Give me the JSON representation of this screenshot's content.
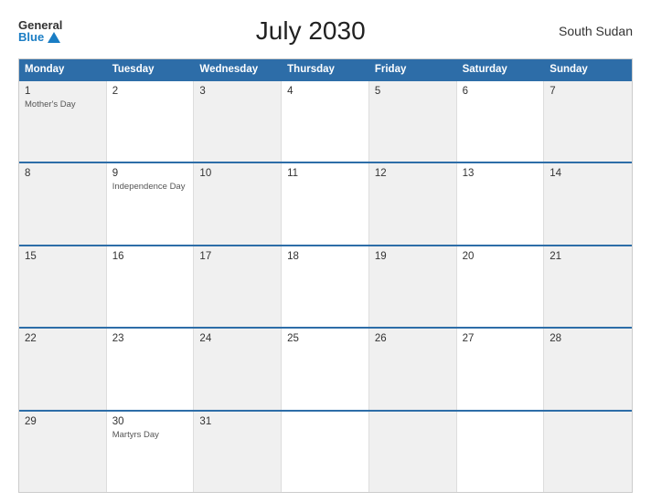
{
  "header": {
    "logo_general": "General",
    "logo_blue": "Blue",
    "title": "July 2030",
    "country": "South Sudan"
  },
  "calendar": {
    "days_of_week": [
      "Monday",
      "Tuesday",
      "Wednesday",
      "Thursday",
      "Friday",
      "Saturday",
      "Sunday"
    ],
    "weeks": [
      [
        {
          "day": "1",
          "event": "Mother's Day",
          "gray": true
        },
        {
          "day": "2",
          "event": "",
          "gray": false
        },
        {
          "day": "3",
          "event": "",
          "gray": true
        },
        {
          "day": "4",
          "event": "",
          "gray": false
        },
        {
          "day": "5",
          "event": "",
          "gray": true
        },
        {
          "day": "6",
          "event": "",
          "gray": false
        },
        {
          "day": "7",
          "event": "",
          "gray": true
        }
      ],
      [
        {
          "day": "8",
          "event": "",
          "gray": true
        },
        {
          "day": "9",
          "event": "Independence Day",
          "gray": false
        },
        {
          "day": "10",
          "event": "",
          "gray": true
        },
        {
          "day": "11",
          "event": "",
          "gray": false
        },
        {
          "day": "12",
          "event": "",
          "gray": true
        },
        {
          "day": "13",
          "event": "",
          "gray": false
        },
        {
          "day": "14",
          "event": "",
          "gray": true
        }
      ],
      [
        {
          "day": "15",
          "event": "",
          "gray": true
        },
        {
          "day": "16",
          "event": "",
          "gray": false
        },
        {
          "day": "17",
          "event": "",
          "gray": true
        },
        {
          "day": "18",
          "event": "",
          "gray": false
        },
        {
          "day": "19",
          "event": "",
          "gray": true
        },
        {
          "day": "20",
          "event": "",
          "gray": false
        },
        {
          "day": "21",
          "event": "",
          "gray": true
        }
      ],
      [
        {
          "day": "22",
          "event": "",
          "gray": true
        },
        {
          "day": "23",
          "event": "",
          "gray": false
        },
        {
          "day": "24",
          "event": "",
          "gray": true
        },
        {
          "day": "25",
          "event": "",
          "gray": false
        },
        {
          "day": "26",
          "event": "",
          "gray": true
        },
        {
          "day": "27",
          "event": "",
          "gray": false
        },
        {
          "day": "28",
          "event": "",
          "gray": true
        }
      ],
      [
        {
          "day": "29",
          "event": "",
          "gray": true
        },
        {
          "day": "30",
          "event": "Martyrs Day",
          "gray": false
        },
        {
          "day": "31",
          "event": "",
          "gray": true
        },
        {
          "day": "",
          "event": "",
          "gray": false
        },
        {
          "day": "",
          "event": "",
          "gray": true
        },
        {
          "day": "",
          "event": "",
          "gray": false
        },
        {
          "day": "",
          "event": "",
          "gray": true
        }
      ]
    ]
  }
}
